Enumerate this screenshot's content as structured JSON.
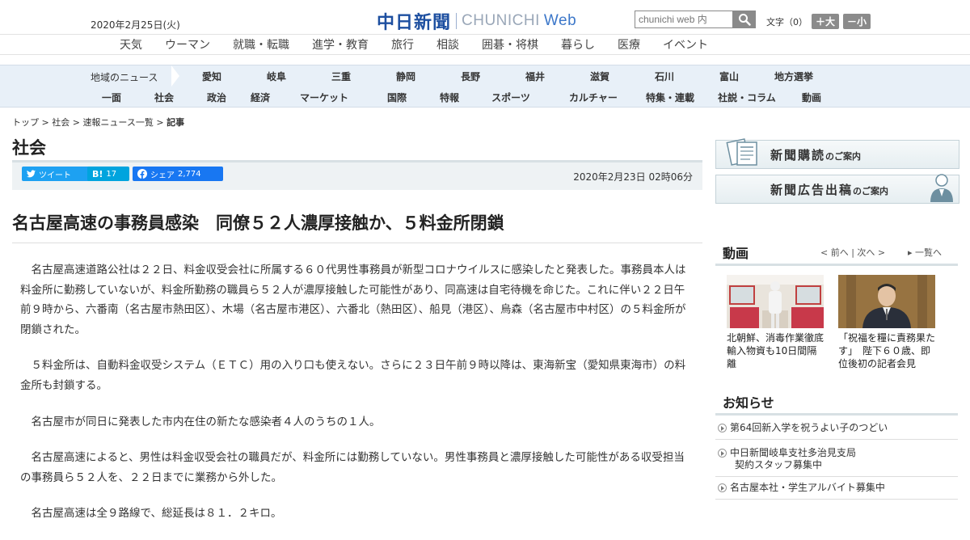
{
  "header": {
    "date": "2020年2月25日(火)",
    "logo_jp": "中日新聞",
    "logo_en": "CHUNICHI",
    "logo_web": "Web",
    "search_placeholder": "chunichi web 内",
    "font_label": "文字（0）",
    "font_bigger": "＋大",
    "font_smaller": "－小"
  },
  "nav_top": [
    "天気",
    "ウーマン",
    "就職・転職",
    "進学・教育",
    "旅行",
    "相談",
    "囲碁・将棋",
    "暮らし",
    "医療",
    "イベント"
  ],
  "nav_region": {
    "label": "地域のニュース",
    "items": [
      "愛知",
      "岐阜",
      "三重",
      "静岡",
      "長野",
      "福井",
      "滋賀",
      "石川",
      "富山",
      "地方選挙"
    ]
  },
  "nav_category": [
    "一面",
    "社会",
    "政治",
    "経済",
    "マーケット",
    "国際",
    "特報",
    "スポーツ",
    "カルチャー",
    "特集・連載",
    "社説・コラム",
    "動画"
  ],
  "breadcrumb": {
    "top": "トップ",
    "sep": " > ",
    "society": "社会",
    "list": "速報ニュース一覧",
    "current": "記事"
  },
  "section_title": "社会",
  "share": {
    "tweet": "ツイート",
    "hatena": "B!",
    "hatena_count": "17",
    "facebook": "シェア",
    "facebook_count": "2,774"
  },
  "article": {
    "date": "2020年2月23日 02時06分",
    "headline": "名古屋高速の事務員感染　同僚５２人濃厚接触か、５料金所閉鎖",
    "paragraphs": [
      "名古屋高速道路公社は２２日、料金収受会社に所属する６０代男性事務員が新型コロナウイルスに感染したと発表した。事務員本人は料金所に勤務していないが、料金所勤務の職員ら５２人が濃厚接触した可能性があり、同高速は自宅待機を命じた。これに伴い２２日午前９時から、六番南（名古屋市熱田区）、木場（名古屋市港区）、六番北（熱田区）、船見（港区）、烏森（名古屋市中村区）の５料金所が閉鎖された。",
      "５料金所は、自動料金収受システム（ＥＴＣ）用の入り口も使えない。さらに２３日午前９時以降は、東海新宝（愛知県東海市）の料金所も封鎖する。",
      "名古屋市が同日に発表した市内在住の新たな感染者４人のうちの１人。",
      "名古屋高速によると、男性は料金収受会社の職員だが、料金所には勤務していない。男性事務員と濃厚接触した可能性がある収受担当の事務員ら５２人を、２２日までに業務から外した。",
      "名古屋高速は全９路線で、総延長は８１．２キロ。"
    ]
  },
  "sidebar": {
    "banner_subscribe": "新聞購読",
    "banner_subscribe_small": "のご案内",
    "banner_ad": "新聞広告出稿",
    "banner_ad_small": "のご案内",
    "video_title": "動画",
    "video_prev": "前へ",
    "video_next": "次へ",
    "video_list": "一覧へ",
    "videos": [
      {
        "caption": "北朝鮮、消毒作業徹底　輸入物資も10日間隔離"
      },
      {
        "caption": "「祝福を糧に責務果たす」　陛下６０歳、即位後初の記者会見"
      }
    ],
    "notice_title": "お知らせ",
    "notices": [
      {
        "line1": "第64回新入学を祝うよい子のつどい",
        "line2": ""
      },
      {
        "line1": "中日新聞岐阜支社多治見支局",
        "line2": "契約スタッフ募集中"
      },
      {
        "line1": "名古屋本社・学生アルバイト募集中",
        "line2": ""
      }
    ]
  },
  "colors": {
    "brand_blue": "#1d4fa0",
    "nav_bg": "#e8f0f8",
    "twitter": "#1da1f2",
    "hatena": "#00a4de",
    "facebook": "#1877f2"
  }
}
